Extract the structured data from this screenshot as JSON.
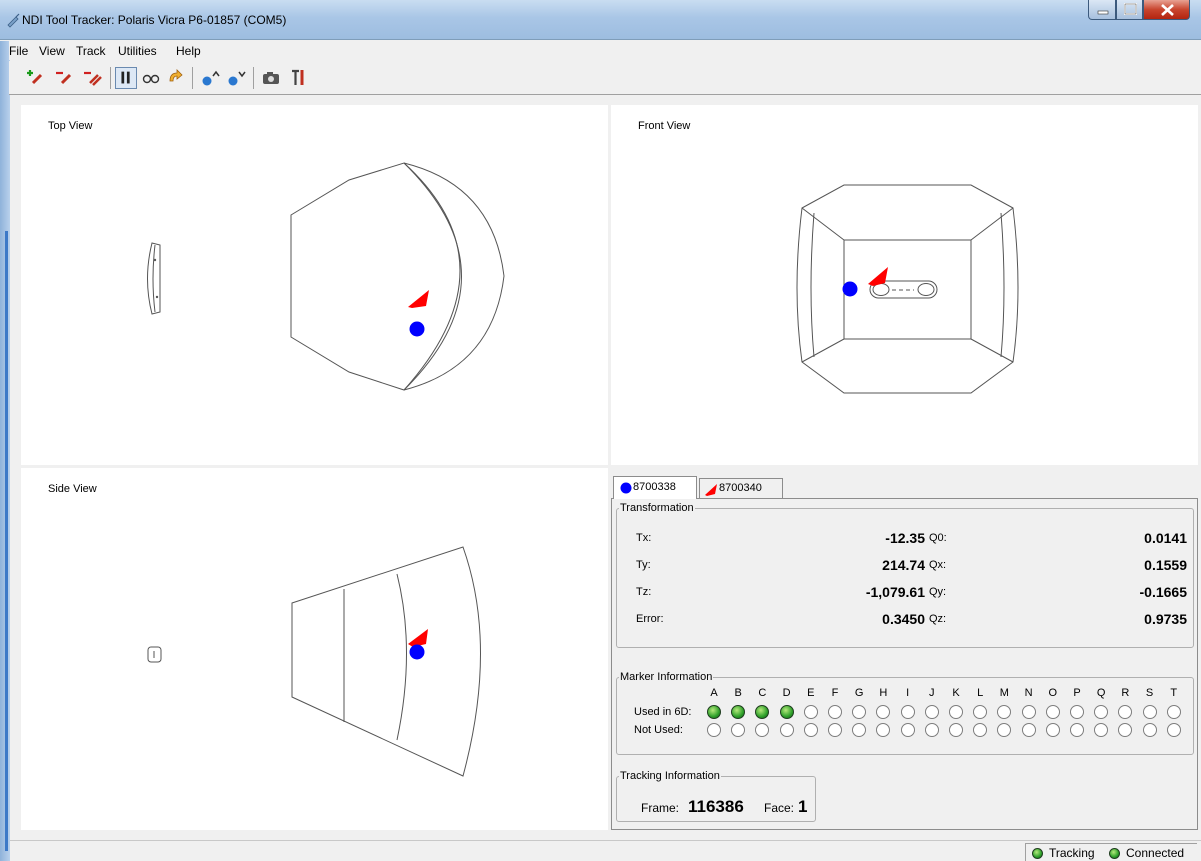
{
  "window": {
    "title": "NDI Tool Tracker: Polaris Vicra P6-01857 (COM5)"
  },
  "menu": [
    "File",
    "View",
    "Track",
    "Utilities",
    "Help"
  ],
  "toolbar": {
    "icons": [
      "add-tool-icon",
      "remove-tool-icon",
      "remove-all-tools-icon",
      "pause-tracking-icon",
      "stray-markers-icon",
      "reset-icon",
      "raise-tool-icon",
      "lower-tool-icon",
      "snapshot-icon",
      "settings-tools-icon"
    ]
  },
  "views": {
    "top": {
      "label": "Top View"
    },
    "front": {
      "label": "Front View"
    },
    "side": {
      "label": "Side View"
    }
  },
  "tools": {
    "tabs": [
      {
        "label": "8700338",
        "marker": "blue-circle",
        "color": "#0000ff"
      },
      {
        "label": "8700340",
        "marker": "red-tool",
        "color": "#ff0000"
      }
    ],
    "transformation": {
      "legend": "Transformation",
      "tx": {
        "label": "Tx:",
        "value": "-12.35"
      },
      "ty": {
        "label": "Ty:",
        "value": "214.74"
      },
      "tz": {
        "label": "Tz:",
        "value": "-1,079.61"
      },
      "error": {
        "label": "Error:",
        "value": "0.3450"
      },
      "q0": {
        "label": "Q0:",
        "value": "0.0141"
      },
      "qx": {
        "label": "Qx:",
        "value": "0.1559"
      },
      "qy": {
        "label": "Qy:",
        "value": "-0.1665"
      },
      "qz": {
        "label": "Qz:",
        "value": "0.9735"
      }
    },
    "markers": {
      "legend": "Marker Information",
      "letters": [
        "A",
        "B",
        "C",
        "D",
        "E",
        "F",
        "G",
        "H",
        "I",
        "J",
        "K",
        "L",
        "M",
        "N",
        "O",
        "P",
        "Q",
        "R",
        "S",
        "T"
      ],
      "used_label": "Used in 6D:",
      "not_used_label": "Not Used:",
      "used_in_6d": [
        true,
        true,
        true,
        true,
        false,
        false,
        false,
        false,
        false,
        false,
        false,
        false,
        false,
        false,
        false,
        false,
        false,
        false,
        false,
        false
      ],
      "not_used": [
        false,
        false,
        false,
        false,
        false,
        false,
        false,
        false,
        false,
        false,
        false,
        false,
        false,
        false,
        false,
        false,
        false,
        false,
        false,
        false
      ]
    },
    "tracking": {
      "legend": "Tracking Information",
      "frame_label": "Frame:",
      "frame": "116386",
      "face_label": "Face:",
      "face": "1"
    }
  },
  "status": {
    "tracking": "Tracking",
    "connected": "Connected",
    "led_color": "#2ea02a"
  }
}
